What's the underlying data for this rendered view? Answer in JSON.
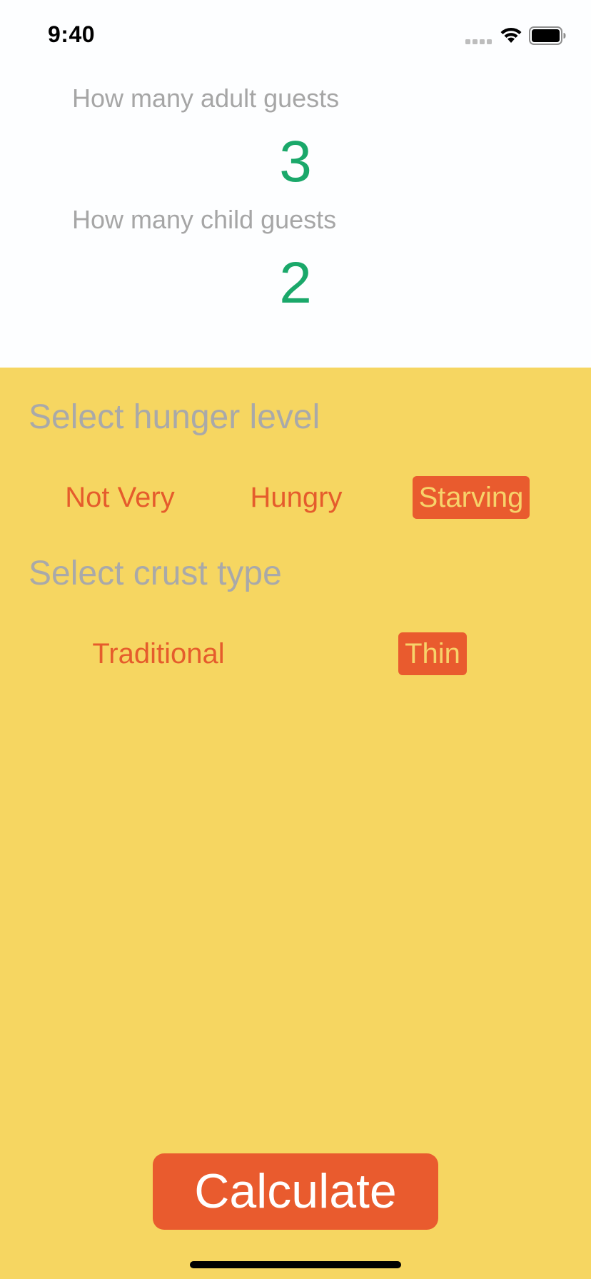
{
  "status_bar": {
    "time": "9:40",
    "icons": [
      "signal-icon",
      "wifi-icon",
      "battery-icon"
    ]
  },
  "guests": {
    "adult_label": "How many adult guests",
    "adult_count": "3",
    "child_label": "How many child guests",
    "child_count": "2"
  },
  "hunger": {
    "title": "Select hunger level",
    "options": [
      "Not Very",
      "Hungry",
      "Starving"
    ],
    "selected": "Starving"
  },
  "crust": {
    "title": "Select crust type",
    "options": [
      "Traditional",
      "Thin"
    ],
    "selected": "Thin"
  },
  "actions": {
    "calculate_label": "Calculate"
  },
  "colors": {
    "panel_background": "#F6D661",
    "accent": "#E95B2E",
    "count_green": "#1AA86A",
    "label_gray": "#A6A6A6"
  }
}
